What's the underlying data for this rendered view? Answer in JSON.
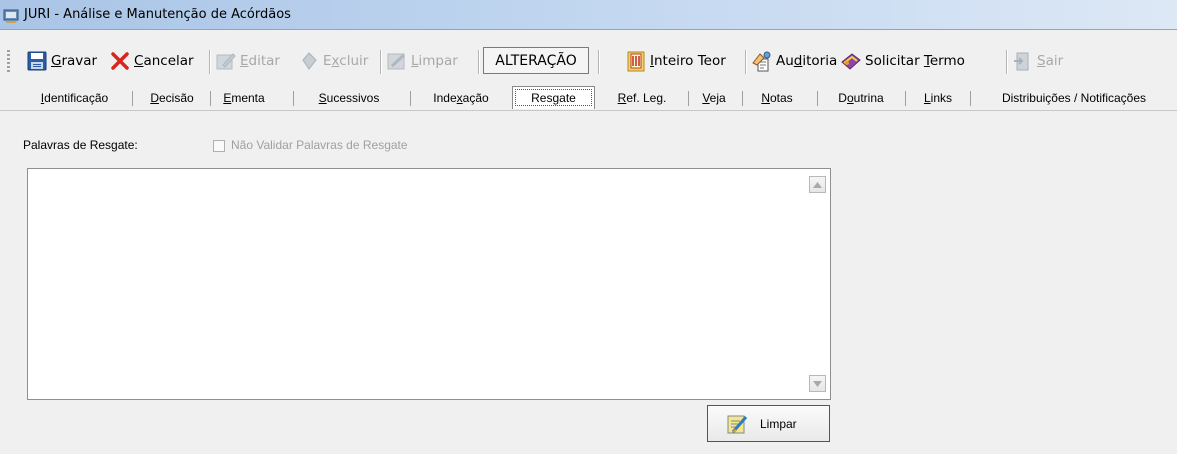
{
  "window": {
    "title": "JURI - Análise e Manutenção de Acórdãos",
    "icon": "app-windows-icon"
  },
  "toolbar": {
    "items": [
      {
        "label": "Gravar",
        "mnemonic": "G",
        "icon": "floppy-save-icon",
        "enabled": true
      },
      {
        "label": "Cancelar",
        "mnemonic": "C",
        "icon": "red-x-icon",
        "enabled": true
      },
      {
        "label": "Editar",
        "mnemonic": "E",
        "icon": "edit-pencil-icon",
        "enabled": false
      },
      {
        "label": "Excluir",
        "mnemonic": "x",
        "icon": "delete-diamond-icon",
        "enabled": false
      },
      {
        "label": "Limpar",
        "mnemonic": "L",
        "icon": "clear-icon",
        "enabled": false
      },
      {
        "label": "Inteiro Teor",
        "mnemonic": "I",
        "icon": "document-teor-icon",
        "enabled": true
      },
      {
        "label": "Auditoria",
        "mnemonic": "d",
        "icon": "audit-icon",
        "enabled": true
      },
      {
        "label": "Solicitar Termo",
        "mnemonic": "T",
        "icon": "book-icon",
        "enabled": true
      },
      {
        "label": "Sair",
        "mnemonic": "S",
        "icon": "exit-door-icon",
        "enabled": false
      }
    ],
    "mode": "ALTERAÇÃO"
  },
  "tabs": [
    {
      "label": "Identificação",
      "active": false
    },
    {
      "label": "Decisão",
      "active": false
    },
    {
      "label": "Ementa",
      "active": false
    },
    {
      "label": "Sucessivos",
      "active": false
    },
    {
      "label": "Indexação",
      "active": false
    },
    {
      "label": "Resgate",
      "active": true
    },
    {
      "label": "Ref. Leg.",
      "active": false
    },
    {
      "label": "Veja",
      "active": false
    },
    {
      "label": "Notas",
      "active": false
    },
    {
      "label": "Doutrina",
      "active": false
    },
    {
      "label": "Links",
      "active": false
    },
    {
      "label": "Distribuições / Notificações",
      "active": false
    }
  ],
  "form": {
    "palavras_label": "Palavras de Resgate:",
    "nao_validar_label": "Não Validar Palavras de Resgate",
    "nao_validar_checked": false,
    "nao_validar_enabled": false,
    "palavras_value": "",
    "limpar_button": "Limpar"
  }
}
